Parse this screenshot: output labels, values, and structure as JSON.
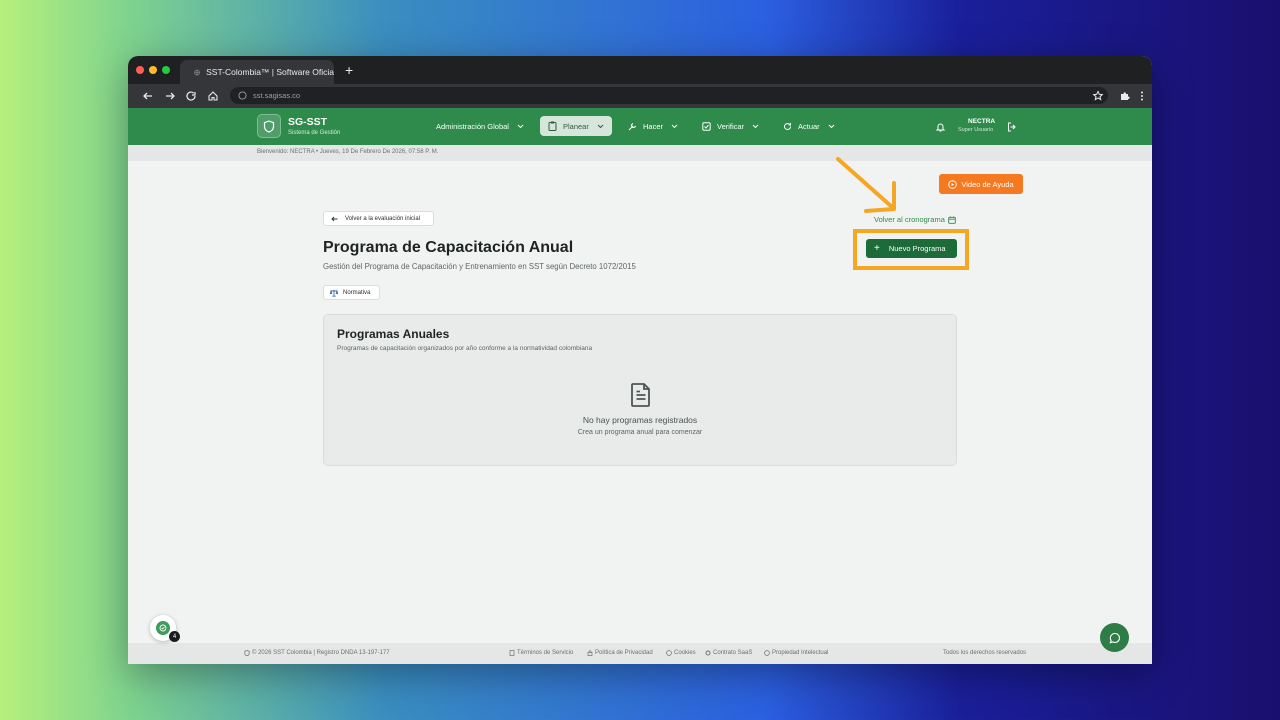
{
  "browser": {
    "tab_title": "SST-Colombia™ | Software Oficia",
    "url": "sst.sagisas.co"
  },
  "header": {
    "brand": "SG-SST",
    "brand_sub": "Sistema de Gestión",
    "menu": [
      {
        "label": "Administración Global",
        "icon": "none",
        "active": false
      },
      {
        "label": "Planear",
        "icon": "clipboard-icon",
        "active": true
      },
      {
        "label": "Hacer",
        "icon": "wrench-icon",
        "active": false
      },
      {
        "label": "Verificar",
        "icon": "check-square-icon",
        "active": false
      },
      {
        "label": "Actuar",
        "icon": "refresh-icon",
        "active": false
      }
    ],
    "user_name": "NECTRA",
    "user_role": "Super Usuario"
  },
  "welcome": "Bienvenido: NECTRA • Jueves, 19 De Febrero De 2026, 07:58 P. M.",
  "help_button": "Video de Ayuda",
  "back_button": "Volver a la evaluación inicial",
  "cronograma_link": "Volver al cronograma",
  "page": {
    "title": "Programa de Capacitación Anual",
    "subtitle": "Gestión del Programa de Capacitación y Entrenamiento en SST según Decreto 1072/2015",
    "badge": "Normativa"
  },
  "new_program_button": "Nuevo Programa",
  "card": {
    "title": "Programas Anuales",
    "description": "Programas de capacitación organizados por año conforme a la normatividad colombiana",
    "empty_title": "No hay programas registrados",
    "empty_sub": "Crea un programa anual para comenzar"
  },
  "footer": {
    "copyright": "© 2026 SST Colombia | Registro DNDA 13-197-177",
    "links": [
      "Términos de Servicio",
      "Política de Privacidad",
      "Cookies",
      "Contrato SaaS",
      "Propiedad Intelectual"
    ],
    "rights": "Todos los derechos reservados"
  },
  "notification_count": "4",
  "colors": {
    "brand_green": "#2e8b4c",
    "accent_orange": "#f47920",
    "highlight": "#f5a623"
  }
}
